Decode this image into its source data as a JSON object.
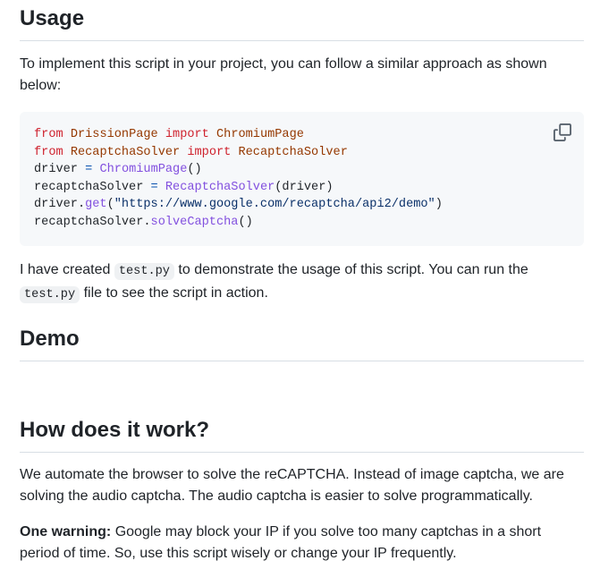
{
  "usage": {
    "heading": "Usage",
    "intro": "To implement this script in your project, you can follow a similar approach as shown below:",
    "code": {
      "line1": {
        "kw1": "from",
        "mod": "DrissionPage",
        "kw2": "import",
        "cls": "ChromiumPage"
      },
      "line2": {
        "kw1": "from",
        "mod": "RecaptchaSolver",
        "kw2": "import",
        "cls": "RecaptchaSolver"
      },
      "line3": {
        "var": "driver",
        "op": "=",
        "call": "ChromiumPage",
        "args": "()"
      },
      "line4": {
        "var": "recaptchaSolver",
        "op": "=",
        "call": "RecaptchaSolver",
        "args": "(driver)"
      },
      "line5": {
        "obj": "driver.",
        "fn": "get",
        "open": "(",
        "str": "\"https://www.google.com/recaptcha/api2/demo\"",
        "close": ")"
      },
      "line6": {
        "obj": "recaptchaSolver.",
        "fn": "solveCaptcha",
        "args": "()"
      }
    },
    "copy_icon": "copy-icon",
    "created_prefix": "I have created",
    "created_code": "test.py",
    "created_middle": "to demonstrate the usage of this script. You can run the",
    "created_code2": "test.py",
    "created_suffix": "file to see the script in action."
  },
  "demo": {
    "heading": "Demo"
  },
  "how": {
    "heading": "How does it work?",
    "explanation": "We automate the browser to solve the reCAPTCHA. Instead of image captcha, we are solving the audio captcha. The audio captcha is easier to solve programmatically.",
    "warning_label": "One warning:",
    "warning_text": "Google may block your IP if you solve too many captchas in a short period of time. So, use this script wisely or change your IP frequently."
  },
  "colors": {
    "keyword": "#cf222e",
    "class_name": "#953800",
    "function": "#8250df",
    "operator": "#0550ae",
    "string": "#0a3069",
    "code_background": "#f6f8fa"
  }
}
